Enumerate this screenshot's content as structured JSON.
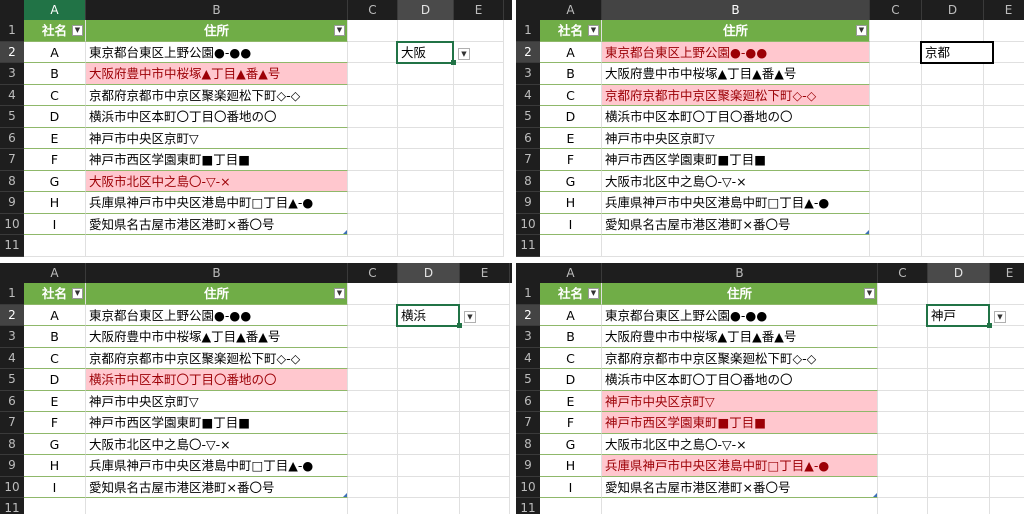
{
  "columns": [
    "A",
    "B",
    "C",
    "D",
    "E"
  ],
  "rows": [
    "1",
    "2",
    "3",
    "4",
    "5",
    "6",
    "7",
    "8",
    "9",
    "10",
    "11"
  ],
  "headers": {
    "a": "社名",
    "b": "住所"
  },
  "filter_icon": "dropdown-arrow-icon",
  "companies": [
    "A",
    "B",
    "C",
    "D",
    "E",
    "F",
    "G",
    "H",
    "I"
  ],
  "addresses": [
    "東京都台東区上野公園●-●●",
    "大阪府豊中市中桜塚▲丁目▲番▲号",
    "京都府京都市中京区聚楽廻松下町◇-◇",
    "横浜市中区本町〇丁目〇番地の〇",
    "神戸市中央区京町▽",
    "神戸市西区学園東町■丁目■",
    "大阪市北区中之島〇-▽-×",
    "兵庫県神戸市中央区港島中町□丁目▲-●",
    "愛知県名古屋市港区港町×番〇号"
  ],
  "panels": [
    {
      "id": "tl",
      "d2": "大阪",
      "highlight": [
        2,
        7
      ]
    },
    {
      "id": "tr",
      "d2": "京都",
      "highlight": [
        1,
        3
      ]
    },
    {
      "id": "bl",
      "d2": "横浜",
      "highlight": [
        4
      ]
    },
    {
      "id": "br",
      "d2": "神戸",
      "highlight": [
        5,
        6,
        8
      ]
    }
  ],
  "colors": {
    "header_green": "#70ad47",
    "highlight_fill": "#ffc7ce",
    "highlight_text": "#9c0006",
    "excel_green": "#217346"
  }
}
